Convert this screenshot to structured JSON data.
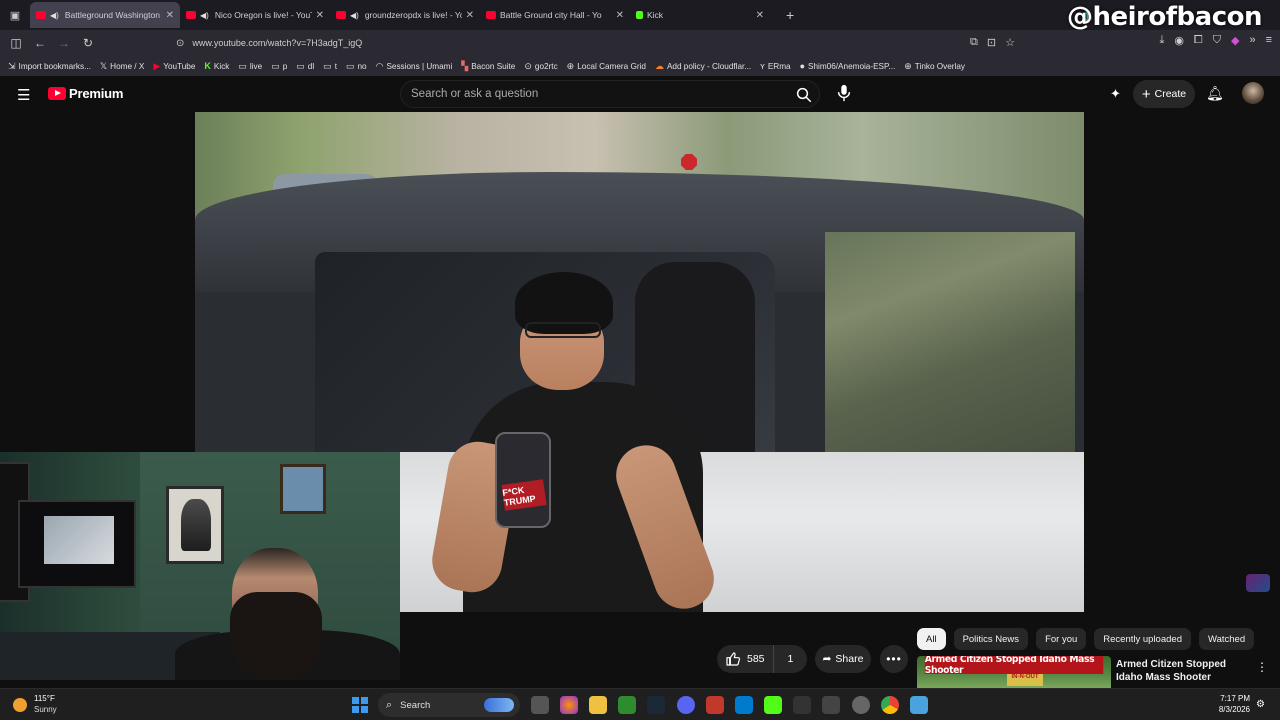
{
  "overlay": {
    "handle": "@heirofbacon"
  },
  "browser": {
    "tabs": [
      {
        "title": "Battleground Washington c",
        "active": true,
        "site": "youtube"
      },
      {
        "title": "Nico Oregon is live! - YouTu",
        "active": false,
        "site": "youtube"
      },
      {
        "title": "groundzeropdx is live! - Yo",
        "active": false,
        "site": "youtube"
      },
      {
        "title": "Battle Ground city Hall - Yo",
        "active": false,
        "site": "youtube"
      },
      {
        "title": "Kick",
        "active": false,
        "site": "kick"
      }
    ],
    "url": "www.youtube.com/watch?v=7H3adgT_igQ",
    "bookmarks": [
      {
        "label": "Import bookmarks...",
        "icon": "import-icon"
      },
      {
        "label": "Home / X",
        "icon": "x-icon"
      },
      {
        "label": "YouTube",
        "icon": "youtube-icon"
      },
      {
        "label": "Kick",
        "icon": "kick-icon"
      },
      {
        "label": "live",
        "icon": "folder-icon"
      },
      {
        "label": "p",
        "icon": "folder-icon"
      },
      {
        "label": "dl",
        "icon": "folder-icon"
      },
      {
        "label": "t",
        "icon": "folder-icon"
      },
      {
        "label": "no",
        "icon": "folder-icon"
      },
      {
        "label": "Sessions | Umami",
        "icon": "umami-icon"
      },
      {
        "label": "Bacon Suite",
        "icon": "bacon-icon"
      },
      {
        "label": "go2rtc",
        "icon": "go2rtc-icon"
      },
      {
        "label": "Local Camera Grid",
        "icon": "globe-icon"
      },
      {
        "label": "Add policy - Cloudflar...",
        "icon": "cloudflare-icon"
      },
      {
        "label": "ERma",
        "icon": "erma-icon"
      },
      {
        "label": "Shim06/Anemoia-ESP...",
        "icon": "github-icon"
      },
      {
        "label": "Tinko Overlay",
        "icon": "globe-icon"
      }
    ]
  },
  "youtube": {
    "logo_text": "Premium",
    "search_placeholder": "Search or ask a question",
    "create_label": "Create",
    "video": {
      "phone_sticker": "F*CK TRUMP"
    },
    "actions": {
      "likes": "585",
      "dislikes": "1",
      "share_label": "Share"
    },
    "chips": [
      "All",
      "Politics News",
      "For you",
      "Recently uploaded",
      "Watched"
    ],
    "active_chip": "All",
    "recommendation": {
      "thumb_banner": "Armed Citizen Stopped Idaho Mass Shooter",
      "thumb_sign": "IN-N-OUT",
      "title": "Armed Citizen Stopped Idaho Mass Shooter"
    }
  },
  "taskbar": {
    "weather_temp": "115°F",
    "weather_condition": "Sunny",
    "search_label": "Search",
    "time": "7:17 PM",
    "date": "8/3/2026"
  }
}
